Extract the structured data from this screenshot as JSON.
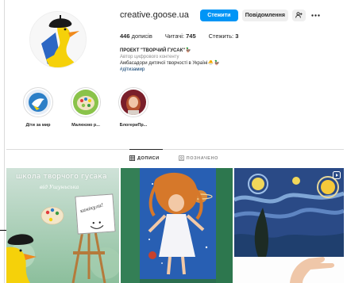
{
  "profile": {
    "username": "creative.goose.ua",
    "follow_label": "Стежити",
    "message_label": "Повідомлення",
    "posts_count": "446",
    "posts_label": "дописів",
    "followers_label": "Читачі:",
    "followers_count": "745",
    "following_label": "Стежить:",
    "following_count": "3",
    "name": "ПРОЕКТ \"ТВОРЧИЙ ГУСАК\"🦆",
    "category": "Автор цифрового контенту",
    "bio": "Амбасадори дитячої творчості в Україні🐣🦆",
    "hashtag": "#дітизамир"
  },
  "highlights": [
    {
      "label": "Діти за мир",
      "color": "#2c7fc7"
    },
    {
      "label": "Малюємо р...",
      "color": "#8ac34a"
    },
    {
      "label": "БлогериПр...",
      "color": "#7a1f2a"
    }
  ],
  "tabs": {
    "posts": "ДОПИСИ",
    "tagged": "ПОЗНАЧЕНО"
  },
  "posts": {
    "post1_title": "школа творчого гусака",
    "post1_subtitle": "від Ушуньська",
    "post1_sign": "канікули!"
  },
  "colors": {
    "accent": "#0095f6",
    "goose_yellow": "#f5d10a"
  }
}
